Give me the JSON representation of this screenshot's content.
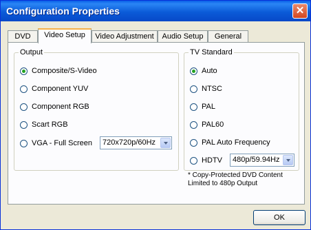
{
  "window": {
    "title": "Configuration Properties"
  },
  "tabs": [
    {
      "label": "DVD"
    },
    {
      "label": "Video Setup"
    },
    {
      "label": "Video Adjustment"
    },
    {
      "label": "Audio Setup"
    },
    {
      "label": "General"
    }
  ],
  "active_tab": "Video Setup",
  "output": {
    "legend": "Output",
    "options": [
      {
        "label": "Composite/S-Video",
        "checked": true
      },
      {
        "label": "Component YUV",
        "checked": false
      },
      {
        "label": "Component RGB",
        "checked": false
      },
      {
        "label": "Scart RGB",
        "checked": false
      },
      {
        "label": "VGA - Full Screen",
        "checked": false
      }
    ],
    "vga_select_value": "720x720p/60Hz"
  },
  "tv_standard": {
    "legend": "TV Standard",
    "options": [
      {
        "label": "Auto",
        "checked": true
      },
      {
        "label": "NTSC",
        "checked": false
      },
      {
        "label": "PAL",
        "checked": false
      },
      {
        "label": "PAL60",
        "checked": false
      },
      {
        "label": "PAL Auto Frequency",
        "checked": false
      },
      {
        "label": "HDTV",
        "checked": false
      }
    ],
    "hdtv_select_value": "480p/59.94Hz",
    "note_line1": "* Copy-Protected DVD Content",
    "note_line2": "Limited to 480p Output"
  },
  "buttons": {
    "ok_label": "OK"
  },
  "icons": {
    "close": "close-icon",
    "dropdown": "chevron-down-icon"
  },
  "colors": {
    "title_bar": "#0a5fe8",
    "close_button": "#d3461f",
    "active_tab_accent": "#f5b14a",
    "radio_dot": "#21a121"
  }
}
